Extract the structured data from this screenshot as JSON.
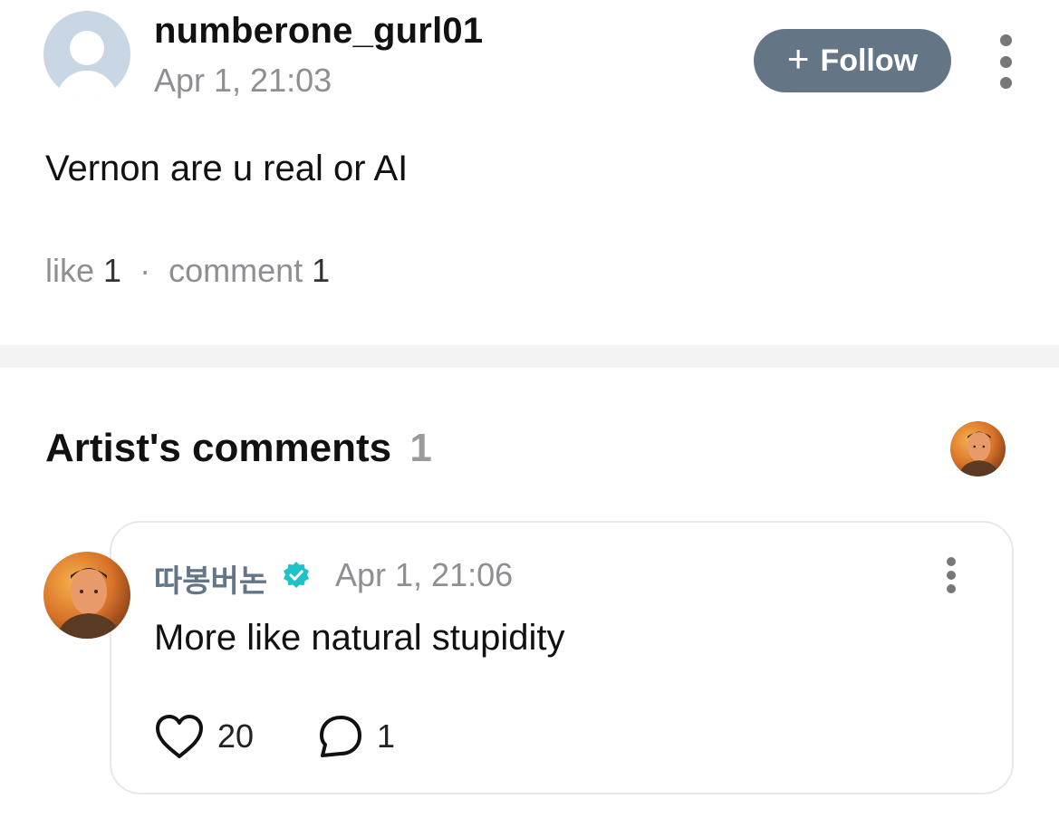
{
  "post": {
    "username": "numberone_gurl01",
    "timestamp": "Apr 1, 21:03",
    "follow_label": "Follow",
    "text": "Vernon are u real or AI",
    "stats": {
      "like_label": "like",
      "like_count": "1",
      "separator": "·",
      "comment_label": "comment",
      "comment_count": "1"
    }
  },
  "artist_comments": {
    "title": "Artist's comments",
    "count": "1",
    "comment": {
      "author": "따봉버논",
      "verified": true,
      "timestamp": "Apr 1, 21:06",
      "text": "More like natural stupidity",
      "likes": "20",
      "replies": "1"
    }
  },
  "colors": {
    "follow_button": "#647585",
    "author_name": "#647585",
    "verified_badge": "#1fc1c9",
    "muted_text": "#8e8e93",
    "divider": "#f3f3f3"
  },
  "icons": [
    "default-avatar-icon",
    "plus-icon",
    "more-options-icon",
    "verified-badge-icon",
    "heart-icon",
    "comment-bubble-icon"
  ]
}
